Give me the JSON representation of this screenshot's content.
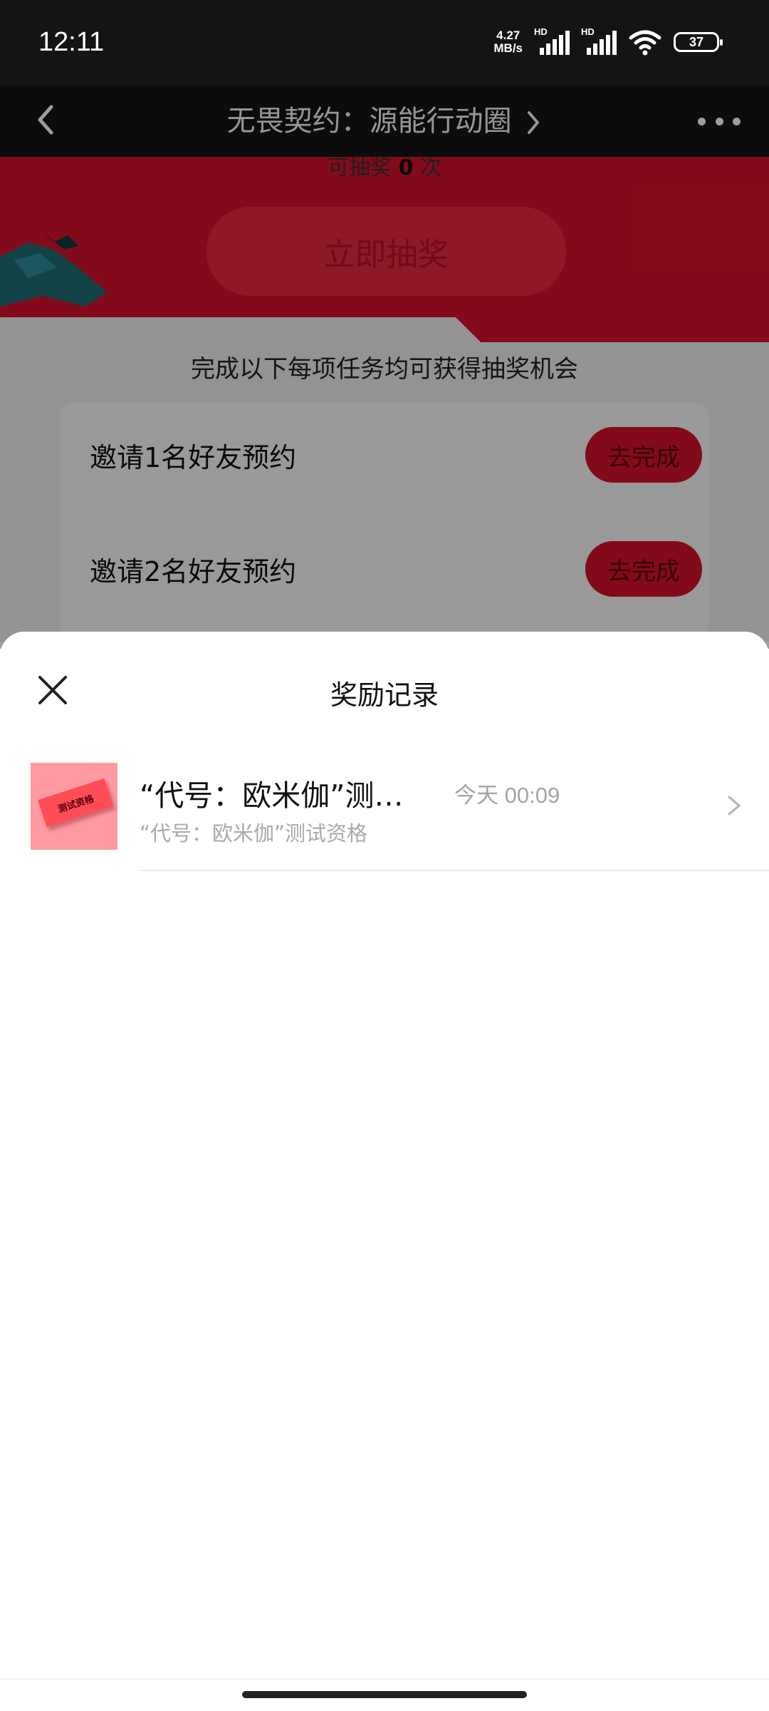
{
  "status_bar": {
    "time": "12:11",
    "net_speed_value": "4.27",
    "net_speed_unit": "MB/s",
    "signal1_label": "HD",
    "signal2_label": "HD",
    "battery": "37"
  },
  "header": {
    "title": "无畏契约：源能行动圈"
  },
  "background_page": {
    "draw_count_prefix": "可抽奖 ",
    "draw_count_value": "0",
    "draw_count_suffix": " 次",
    "draw_button": "立即抽奖",
    "tasks_title": "完成以下每项任务均可获得抽奖机会",
    "tasks": [
      {
        "label": "邀请1名好友预约",
        "button": "去完成"
      },
      {
        "label": "邀请2名好友预约",
        "button": "去完成"
      }
    ]
  },
  "sheet": {
    "title": "奖励记录",
    "records": [
      {
        "thumb_text": "测试资格",
        "title": "“代号：欧米伽”测…",
        "time": "今天 00:09",
        "subtitle": "“代号：欧米伽”测试资格"
      }
    ]
  },
  "colors": {
    "brand_red": "#d3112a",
    "status_bg": "#141414",
    "thumb_pink": "#ff9aa3"
  }
}
